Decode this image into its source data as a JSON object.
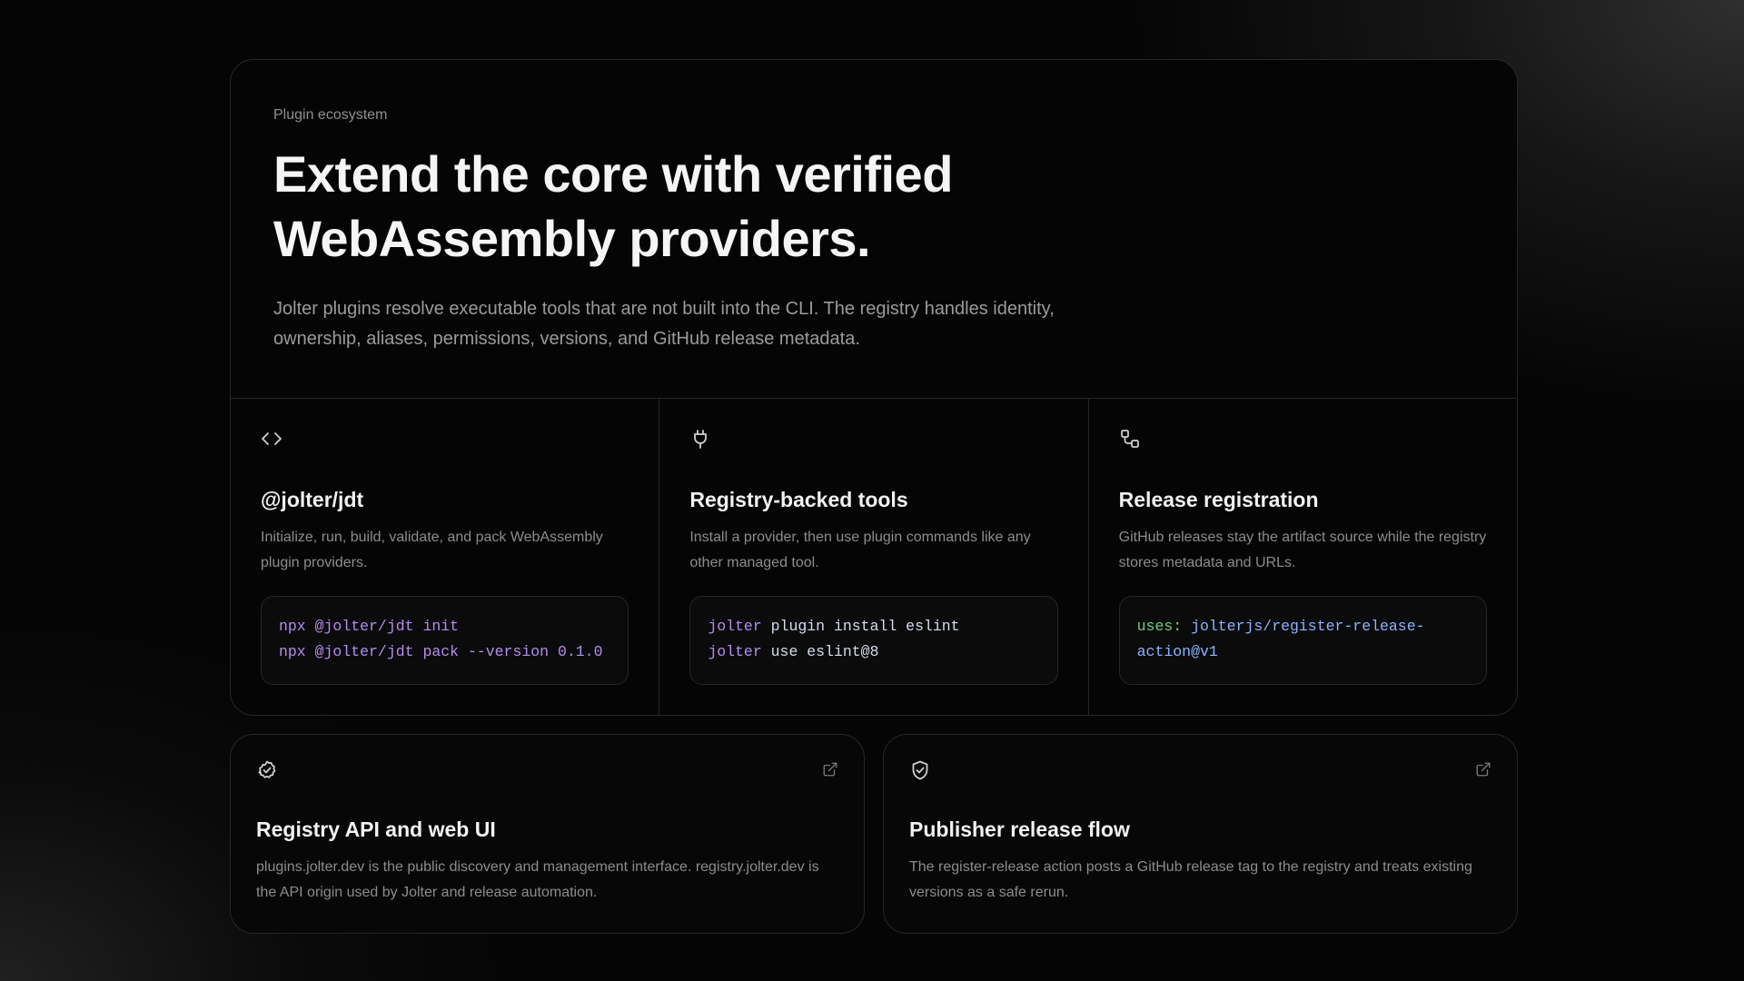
{
  "hero": {
    "eyebrow": "Plugin ecosystem",
    "headline": "Extend the core with verified WebAssembly providers.",
    "description": "Jolter plugins resolve executable tools that are not built into the CLI. The registry handles identity, ownership, aliases, permissions, versions, and GitHub release metadata."
  },
  "features": [
    {
      "icon": "code-brackets-icon",
      "title": "@jolter/jdt",
      "description": "Initialize, run, build, validate, and pack WebAssembly plugin providers.",
      "code": [
        [
          "npx",
          " @jolter/jdt init"
        ],
        [
          "npx",
          " @jolter/jdt pack --version 0.1.0"
        ]
      ]
    },
    {
      "icon": "plug-icon",
      "title": "Registry-backed tools",
      "description": "Install a provider, then use plugin commands like any other managed tool.",
      "code": [
        [
          "jolter",
          " plugin install eslint"
        ],
        [
          "jolter",
          " use eslint@8"
        ]
      ]
    },
    {
      "icon": "workflow-icon",
      "title": "Release registration",
      "description": "GitHub releases stay the artifact source while the registry stores metadata and URLs.",
      "code": [
        [
          "uses:",
          " jolterjs/register-release-action@v1"
        ]
      ]
    }
  ],
  "links": [
    {
      "icon": "badge-check-icon",
      "title": "Registry API and web UI",
      "description": "plugins.jolter.dev is the public discovery and management interface. registry.jolter.dev is the API origin used by Jolter and release automation."
    },
    {
      "icon": "shield-check-icon",
      "title": "Publisher release flow",
      "description": "The register-release action posts a GitHub release tag to the registry and treats existing versions as a safe rerun."
    }
  ],
  "colors": {
    "background": "#050505",
    "border": "#262626",
    "command": "#b48df0",
    "argument": "#d6dced",
    "yaml_key": "#6fd07e",
    "yaml_value": "#8ab4ff"
  }
}
